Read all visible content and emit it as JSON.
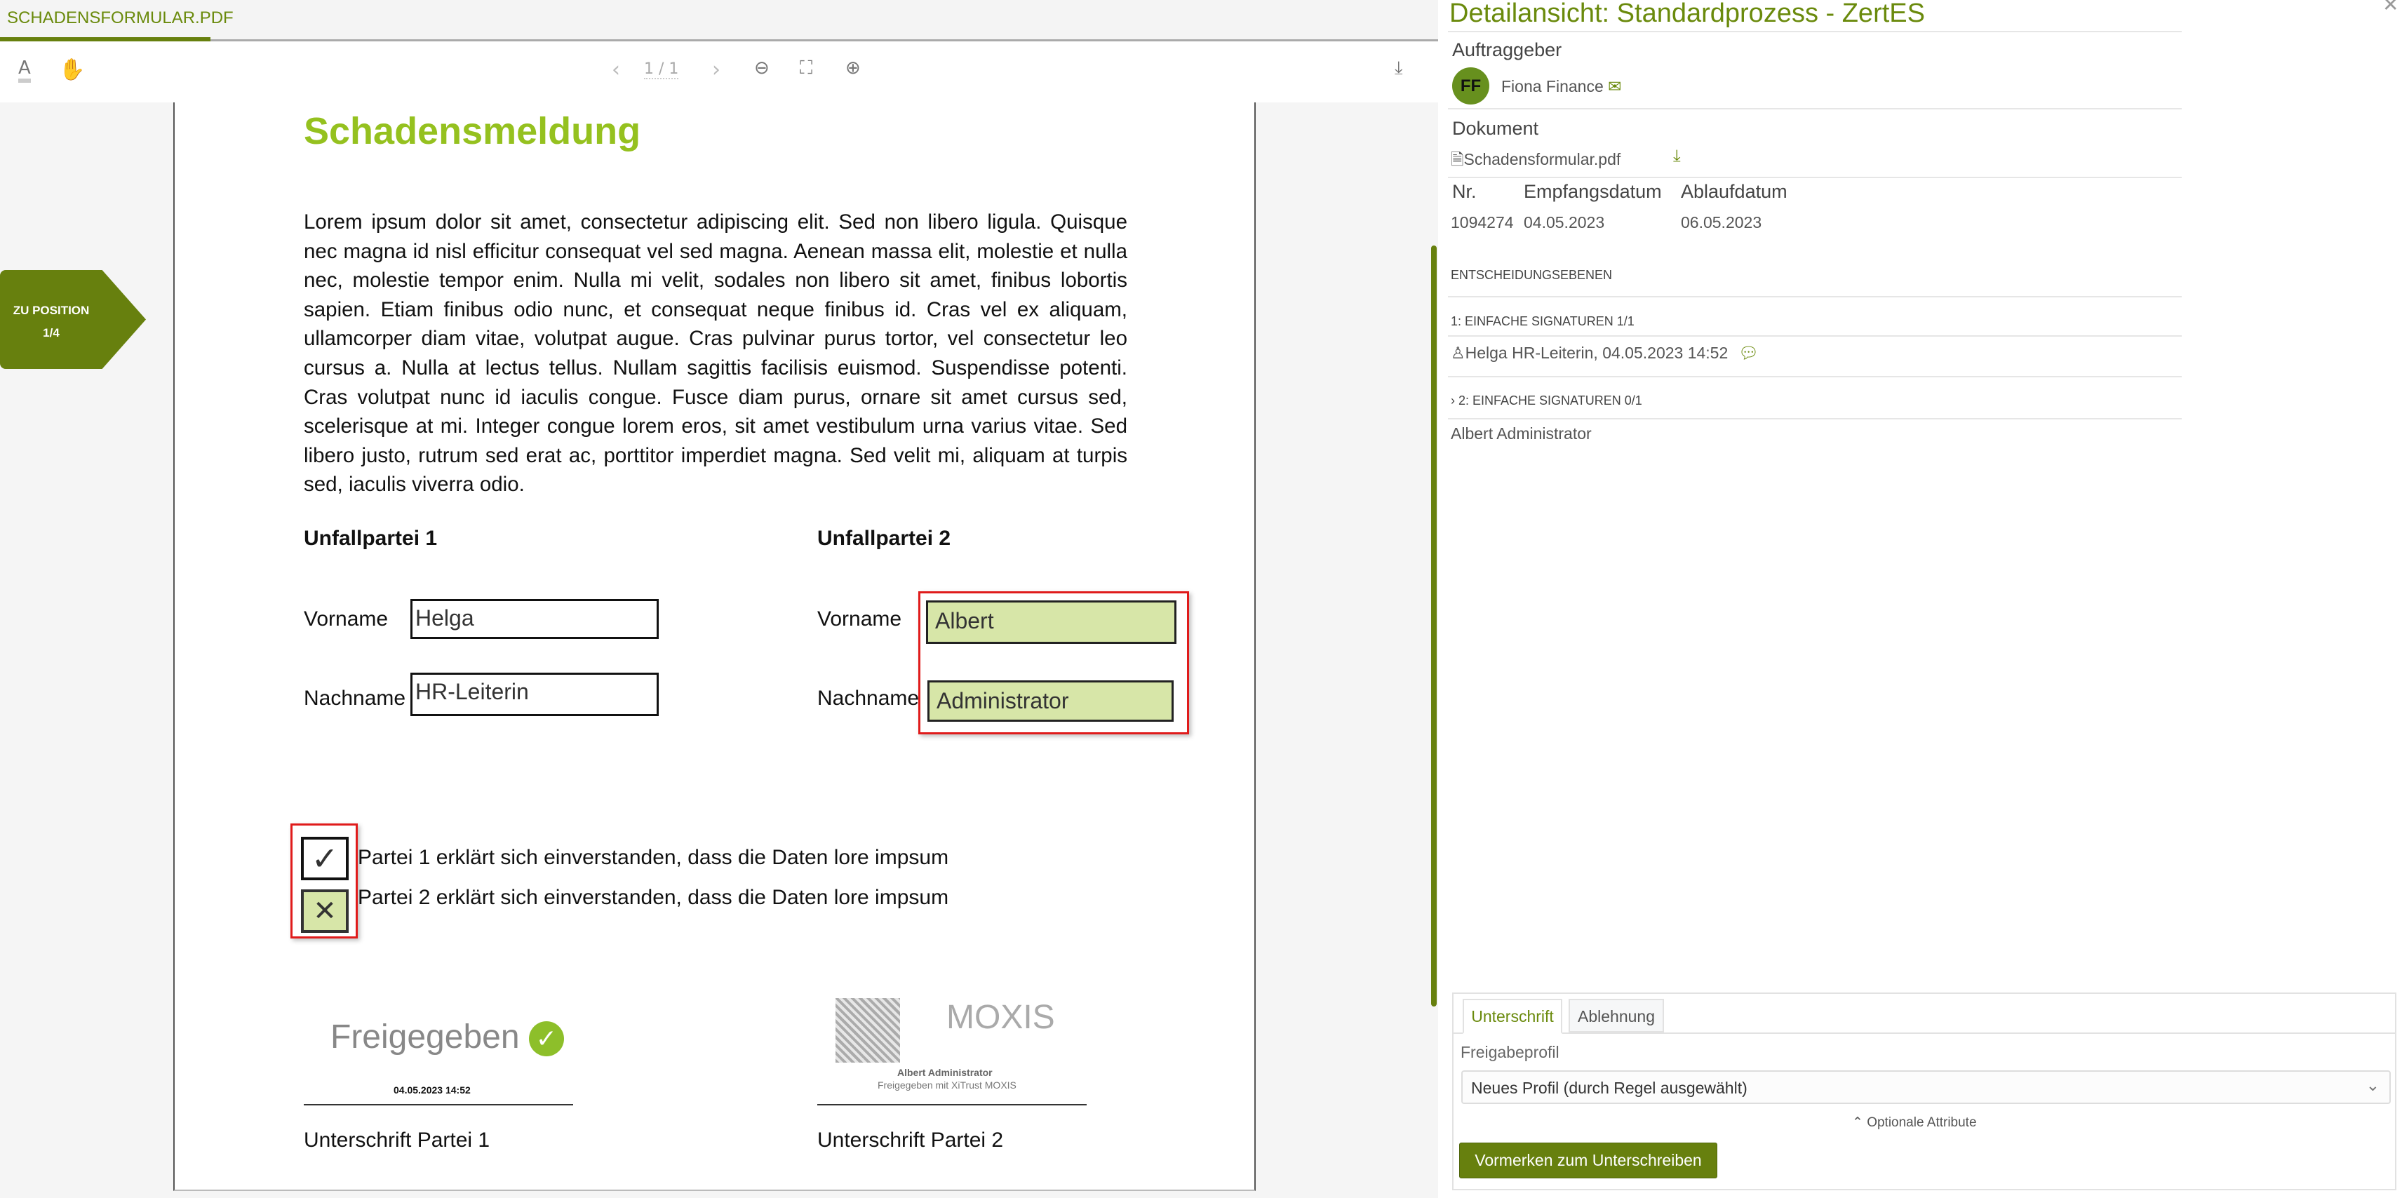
{
  "viewer": {
    "tab_label": "SCHADENSFORMULAR.PDF",
    "toolbar": {
      "page_indicator": "1 / 1",
      "text_tool": "A"
    },
    "position_badge": {
      "line1": "ZU POSITION",
      "line2": "1/4"
    },
    "document": {
      "title": "Schadensmeldung",
      "paragraph": "Lorem ipsum dolor sit amet, consectetur adipiscing elit. Sed non libero ligula. Quisque nec magna id nisl efficitur consequat vel sed magna. Aenean massa elit, molestie et nulla nec, molestie tempor enim. Nulla mi velit, sodales non libero sit amet, finibus lobortis sapien. Etiam finibus odio nunc, et consequat neque finibus id. Cras vel ex aliquam, ullamcorper diam vitae, volutpat augue. Cras pulvinar purus tortor, vel consectetur leo cursus a. Nulla at lectus tellus. Nullam sagittis facilisis euismod. Suspendisse potenti. Cras volutpat nunc id iaculis congue. Fusce diam purus, ornare sit amet cursus sed, scelerisque at mi. Integer congue lorem eros, sit amet vestibulum urna varius vitae. Sed libero justo, rutrum sed erat ac, porttitor imperdiet magna. Sed velit mi, aliquam at turpis sed, iaculis viverra odio.",
      "party1": {
        "heading": "Unfallpartei 1",
        "vorname_label": "Vorname",
        "vorname": "Helga",
        "nachname_label": "Nachname",
        "nachname": "HR-Leiterin"
      },
      "party2": {
        "heading": "Unfallpartei 2",
        "vorname_label": "Vorname",
        "vorname": "Albert",
        "nachname_label": "Nachname",
        "nachname": "Administrator"
      },
      "checkbox1": {
        "label": "Partei 1 erklärt sich einverstanden, dass die Daten lore impsum",
        "mark": "✓"
      },
      "checkbox2": {
        "label": "Partei 2 erklärt sich einverstanden, dass die Daten lore impsum",
        "mark": "✕"
      },
      "sig1": {
        "stamp": "Freigegeben",
        "date": "04.05.2023 14:52",
        "label": "Unterschrift Partei 1"
      },
      "sig2": {
        "stamp_logo": "MOXIS",
        "name": "Albert Administrator",
        "note": "Freigegeben mit XiTrust MOXIS",
        "label": "Unterschrift Partei 2"
      }
    }
  },
  "panel": {
    "title": "Detailansicht: Standardprozess - ZertES",
    "auftraggeber_label": "Auftraggeber",
    "avatar_initials": "FF",
    "requester": "Fiona Finance",
    "dokument_label": "Dokument",
    "filename": "Schadensformular.pdf",
    "columns": [
      "Nr.",
      "Empfangsdatum",
      "Ablaufdatum"
    ],
    "values": [
      "1094274",
      "04.05.2023",
      "06.05.2023"
    ],
    "levels_heading": "ENTSCHEIDUNGSEBENEN",
    "level1": "1: EINFACHE SIGNATUREN 1/1",
    "level1_signer": "Helga HR-Leiterin, 04.05.2023 14:52",
    "level2": "2: EINFACHE SIGNATUREN 0/1",
    "level2_signer": "Albert Administrator",
    "tabs": [
      "Unterschrift",
      "Ablehnung"
    ],
    "profile_label": "Freigabeprofil",
    "profile_value": "Neues Profil (durch Regel ausgewählt)",
    "optional": "Optionale Attribute",
    "submit": "Vormerken zum Unterschreiben"
  },
  "colors": {
    "accent": "#67800e",
    "doc_green": "#95c11f",
    "highlight": "#d7e6a8",
    "marker": "#e01b1b"
  }
}
